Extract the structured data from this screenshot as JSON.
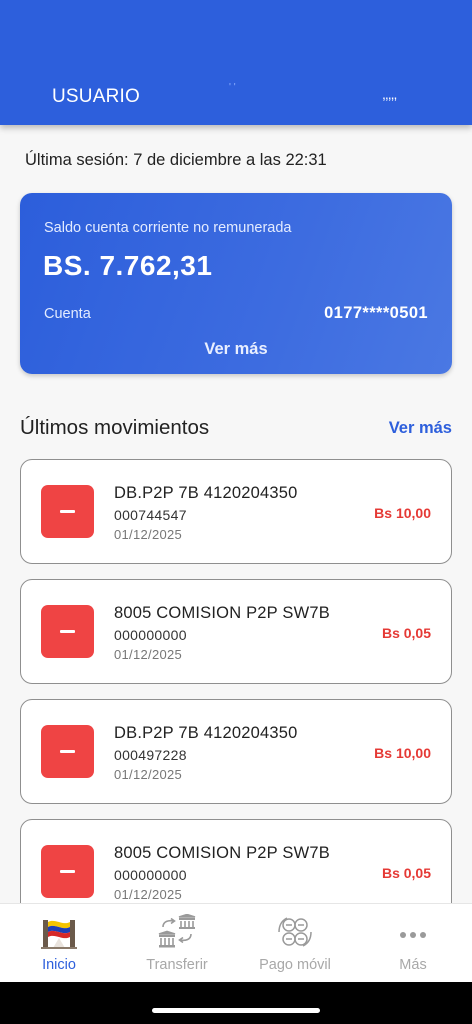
{
  "header": {
    "user_label": "USUARIO",
    "mark": "' '",
    "right_mark": ",,,,,"
  },
  "session": {
    "last_session": "Última sesión: 7 de diciembre a las 22:31"
  },
  "balance_card": {
    "caption": "Saldo cuenta corriente no remunerada",
    "amount": "BS. 7.762,31",
    "account_label": "Cuenta",
    "account_number": "0177****0501",
    "more_label": "Ver más"
  },
  "movements_section": {
    "title": "Últimos movimientos",
    "more_label": "Ver más"
  },
  "movements": [
    {
      "title": "DB.P2P 7B 4120204350",
      "ref": "000744547",
      "date": "01/12/2025",
      "amount": "Bs 10,00"
    },
    {
      "title": "8005 COMISION P2P SW7B",
      "ref": "000000000",
      "date": "01/12/2025",
      "amount": "Bs 0,05"
    },
    {
      "title": "DB.P2P 7B 4120204350",
      "ref": "000497228",
      "date": "01/12/2025",
      "amount": "Bs 10,00"
    },
    {
      "title": "8005 COMISION P2P SW7B",
      "ref": "000000000",
      "date": "01/12/2025",
      "amount": "Bs 0,05"
    }
  ],
  "bottom_nav": {
    "items": [
      {
        "label": "Inicio",
        "icon": "home-flag-icon",
        "active": true
      },
      {
        "label": "Transferir",
        "icon": "bank-transfer-icon",
        "active": false
      },
      {
        "label": "Pago móvil",
        "icon": "mobile-payment-icon",
        "active": false
      },
      {
        "label": "Más",
        "icon": "more-dots-icon",
        "active": false
      }
    ]
  },
  "colors": {
    "primary": "#2d5fdc",
    "debit": "#e53935",
    "debit_box": "#ef4444",
    "inactive": "#a8a8a8"
  }
}
